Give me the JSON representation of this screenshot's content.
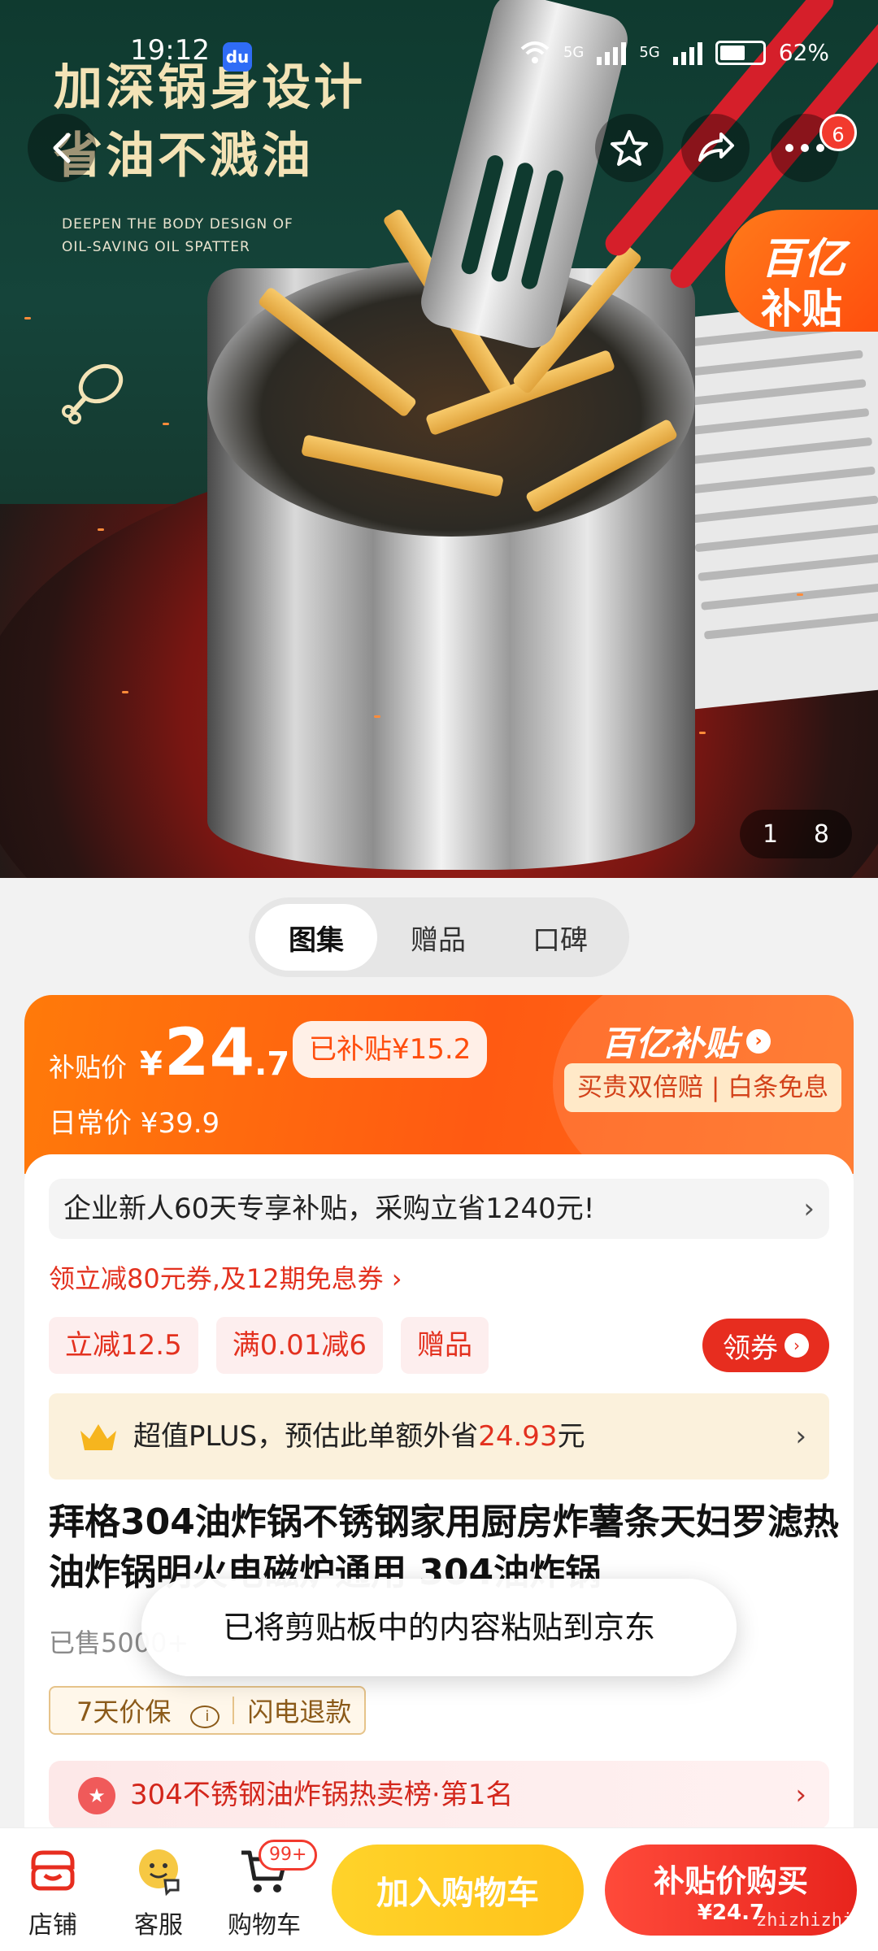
{
  "status_bar": {
    "time": "19:12",
    "app_badge": "du",
    "signal": [
      "5G",
      "5G"
    ],
    "battery": "62%"
  },
  "hero": {
    "title_line1": "加深锅身设计",
    "title_line2": "省油不溅油",
    "subtitle_line1": "DEEPEN THE BODY DESIGN OF",
    "subtitle_line2": "OIL-SAVING OIL SPATTER",
    "badge_line1": "百亿",
    "badge_line2": "补贴",
    "page_current": "1",
    "page_total": "8",
    "more_badge": "6"
  },
  "tabs": [
    {
      "label": "图集",
      "active": true
    },
    {
      "label": "赠品",
      "active": false
    },
    {
      "label": "口碑",
      "active": false
    }
  ],
  "price": {
    "label": "补贴价",
    "yen": "¥",
    "main": "24",
    "decimal": ".7",
    "subsidized": "已补贴¥15.2",
    "daily": "日常价 ¥39.9",
    "brand": "百亿补贴",
    "brand_arrow": "›",
    "guarantee": "买贵双倍赔 | 白条免息"
  },
  "promos": {
    "enterprise": "企业新人60天专享补贴，采购立省1240元!",
    "coupon_link": "领立减80元券,及12期免息券 ›",
    "chips": [
      "立减12.5",
      "满0.01减6",
      "赠品"
    ],
    "get_coupon": "领券",
    "plus_prefix": "超值PLUS，预估此单额外省",
    "plus_amount": "24.93",
    "plus_suffix": "元"
  },
  "product": {
    "title": "拜格304油炸锅不锈钢家用厨房炸薯条天妇罗滤热油炸锅明火电磁炉通用 304油炸锅",
    "sold": "已售5000+",
    "services": [
      "7天价保",
      "闪电退款"
    ],
    "rank": "304不锈钢油炸锅热卖榜·第1名"
  },
  "toast": "已将剪贴板中的内容粘贴到京东",
  "bottom_nav": {
    "store": "店铺",
    "service": "客服",
    "cart": "购物车",
    "cart_badge": "99+",
    "add_cart": "加入购物车",
    "buy_line1": "补贴价购买",
    "buy_line2": "¥24.7"
  },
  "watermark": "zhizhizhi.com",
  "colors": {
    "accent_orange": "#ff5a12",
    "accent_red": "#e72d1f",
    "cart_yellow": "#ffc21a",
    "hero_green": "#0f3a2f"
  }
}
